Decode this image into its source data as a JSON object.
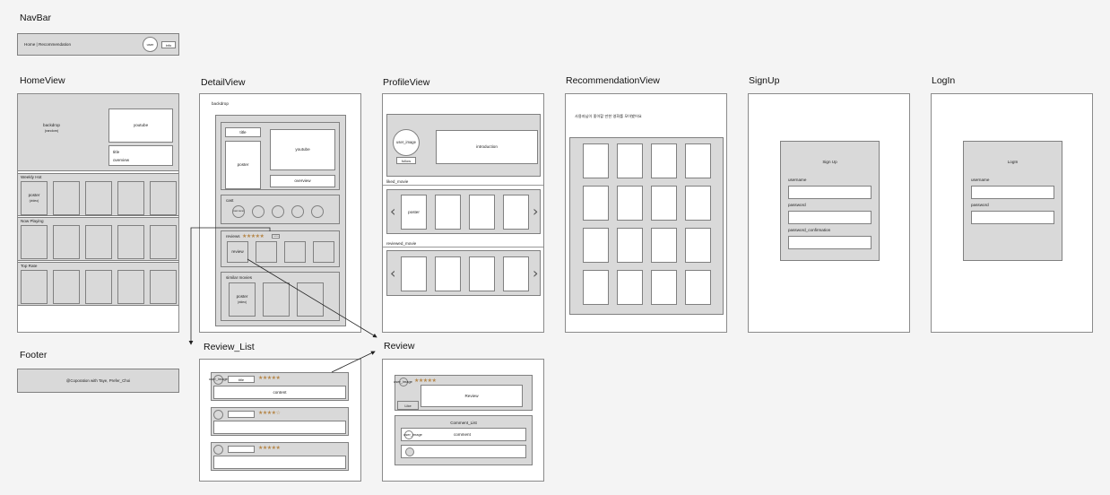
{
  "titles": {
    "navbar": "NavBar",
    "home": "HomeView",
    "detail": "DetailView",
    "profile": "ProfileView",
    "recommendation": "RecommendationView",
    "signup": "SignUp",
    "login": "LogIn",
    "footer": "Footer",
    "review_list": "Review_List",
    "review": "Review"
  },
  "navbar": {
    "links": "Home | Recommendation",
    "user": "user",
    "info": "info"
  },
  "home": {
    "backdrop": "backdrop",
    "backdrop_sub": "(random)",
    "youtube": "youtube",
    "title": "title",
    "overview": "overview",
    "sections": [
      "Weekly Hot",
      "Now Playing",
      "Top Rate"
    ],
    "poster": "poster",
    "poster_sub": "(video)"
  },
  "detail": {
    "backdrop": "backdrop",
    "title": "title",
    "poster": "poster",
    "youtube": "youtube",
    "overview": "overview",
    "cast": "cast",
    "cast_label": "cast name",
    "reviews": "reviews",
    "more": "more",
    "review": "review",
    "similar": "similar movies",
    "poster_sub": "(video)"
  },
  "profile": {
    "user_image": "user_image",
    "follow": "follow",
    "introduction": "introduction",
    "liked": "liked_movie",
    "reviewed": "reviewed_movie",
    "poster": "poster"
  },
  "recommendation": {
    "text": "사용자님이 좋아할 만한 영화를 모아봤어요"
  },
  "signup": {
    "heading": "Sign Up",
    "username": "username",
    "password": "password",
    "password_confirmation": "password_confirmation"
  },
  "login": {
    "heading": "LogIn",
    "username": "username",
    "password": "password"
  },
  "footer": {
    "text": "@Coporation with Taye, Prefer_Choi"
  },
  "review_list": {
    "user_image": "user_image",
    "title": "title",
    "content": "content",
    "stars": [
      "★★★★★",
      "★★★★☆",
      "★★★★★"
    ]
  },
  "review": {
    "user_image": "user_image",
    "stars": "★★★★★",
    "review": "Review",
    "like": "Like",
    "comment_list": "Comment_List",
    "comment_user": "user_image",
    "comment": "comment"
  },
  "colors": {
    "frame_bg": "#ffffff",
    "block_gray": "#d9d9d9",
    "border": "#808080",
    "star": "#b5874a"
  }
}
